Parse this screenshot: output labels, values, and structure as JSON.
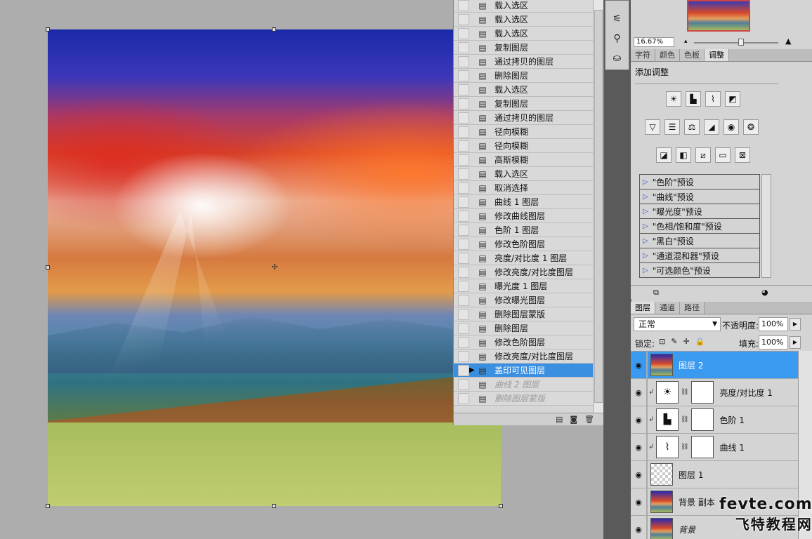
{
  "history": {
    "items": [
      {
        "label": "载入选区",
        "state": "normal"
      },
      {
        "label": "载入选区",
        "state": "normal"
      },
      {
        "label": "载入选区",
        "state": "normal"
      },
      {
        "label": "复制图层",
        "state": "normal"
      },
      {
        "label": "通过拷贝的图层",
        "state": "normal"
      },
      {
        "label": "删除图层",
        "state": "normal"
      },
      {
        "label": "载入选区",
        "state": "normal"
      },
      {
        "label": "复制图层",
        "state": "normal"
      },
      {
        "label": "通过拷贝的图层",
        "state": "normal"
      },
      {
        "label": "径向模糊",
        "state": "normal"
      },
      {
        "label": "径向模糊",
        "state": "normal"
      },
      {
        "label": "高斯模糊",
        "state": "normal"
      },
      {
        "label": "载入选区",
        "state": "normal"
      },
      {
        "label": "取消选择",
        "state": "normal"
      },
      {
        "label": "曲线 1 图层",
        "state": "normal"
      },
      {
        "label": "修改曲线图层",
        "state": "normal"
      },
      {
        "label": "色阶 1 图层",
        "state": "normal"
      },
      {
        "label": "修改色阶图层",
        "state": "normal"
      },
      {
        "label": "亮度/对比度 1 图层",
        "state": "normal"
      },
      {
        "label": "修改亮度/对比度图层",
        "state": "normal"
      },
      {
        "label": "曝光度 1 图层",
        "state": "normal"
      },
      {
        "label": "修改曝光图层",
        "state": "normal"
      },
      {
        "label": "删除图层蒙版",
        "state": "normal"
      },
      {
        "label": "删除图层",
        "state": "normal"
      },
      {
        "label": "修改色阶图层",
        "state": "normal"
      },
      {
        "label": "修改亮度/对比度图层",
        "state": "normal"
      },
      {
        "label": "盖印可见图层",
        "state": "selected"
      },
      {
        "label": "曲线 2 图层",
        "state": "dim"
      },
      {
        "label": "删除图层蒙版",
        "state": "dim"
      }
    ]
  },
  "navigator": {
    "zoom": "16.67%"
  },
  "adjust_tabs": [
    "字符",
    "颜色",
    "色板",
    "调整"
  ],
  "adjust_active": "调整",
  "adjustments": {
    "title": "添加调整",
    "presets": [
      "\"色阶\"预设",
      "\"曲线\"预设",
      "\"曝光度\"预设",
      "\"色相/饱和度\"预设",
      "\"黑白\"预设",
      "\"通道混和器\"预设",
      "\"可选颜色\"预设"
    ]
  },
  "layer_tabs": [
    "图层",
    "通道",
    "路径"
  ],
  "layer_active": "图层",
  "layers": {
    "blend_mode": "正常",
    "opacity_label": "不透明度:",
    "opacity": "100%",
    "lock_label": "锁定:",
    "fill_label": "填充:",
    "fill": "100%",
    "items": [
      {
        "name": "图层 2",
        "type": "photo",
        "selected": true
      },
      {
        "name": "亮度/对比度 1",
        "type": "adjustment",
        "icon": "sun-icon"
      },
      {
        "name": "色阶 1",
        "type": "adjustment",
        "icon": "histogram-icon"
      },
      {
        "name": "曲线 1",
        "type": "adjustment",
        "icon": "curves-icon"
      },
      {
        "name": "图层 1",
        "type": "transparent"
      },
      {
        "name": "背景 副本",
        "type": "photo"
      },
      {
        "name": "背景",
        "type": "photo"
      }
    ]
  },
  "watermark": {
    "line1": "fevte.com",
    "line2": "飞特教程网"
  }
}
